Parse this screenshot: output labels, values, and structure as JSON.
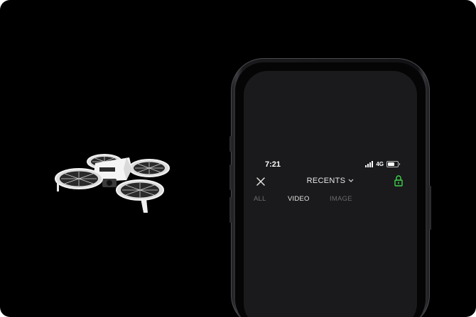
{
  "status_bar": {
    "time": "7:21",
    "network": "4G"
  },
  "header": {
    "title": "RECENTS"
  },
  "tabs": [
    {
      "label": "ALL",
      "active": false
    },
    {
      "label": "VIDEO",
      "active": true
    },
    {
      "label": "IMAGE",
      "active": false
    }
  ],
  "icons": {
    "close": "close-icon",
    "dropdown": "chevron-down-icon",
    "lock": "lock-icon",
    "signal": "signal-icon",
    "battery": "battery-icon"
  },
  "colors": {
    "background": "#000000",
    "screen": "#1a1a1c",
    "lock_accent": "#3fd24a"
  }
}
